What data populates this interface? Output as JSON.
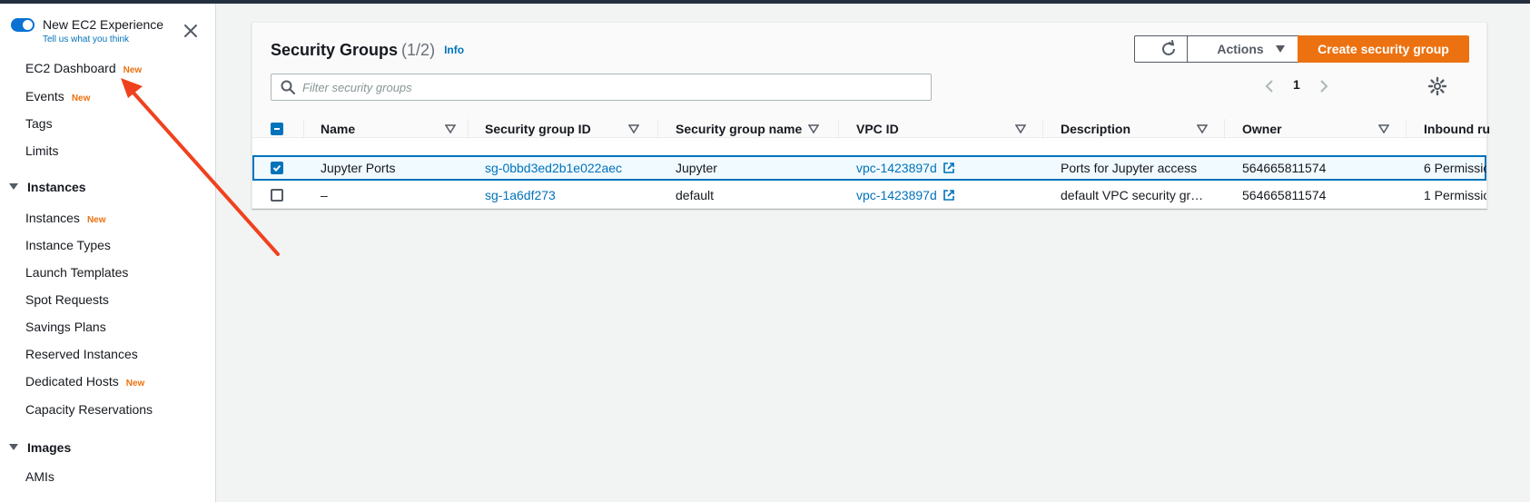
{
  "sidebar": {
    "experience_title": "New EC2 Experience",
    "experience_link": "Tell us what you think",
    "new_badge": "New",
    "items_top": [
      {
        "label": "EC2 Dashboard",
        "new": true
      },
      {
        "label": "Events",
        "new": true
      },
      {
        "label": "Tags",
        "new": false
      },
      {
        "label": "Limits",
        "new": false
      }
    ],
    "sections": [
      {
        "title": "Instances",
        "items": [
          {
            "label": "Instances",
            "new": true
          },
          {
            "label": "Instance Types",
            "new": false
          },
          {
            "label": "Launch Templates",
            "new": false
          },
          {
            "label": "Spot Requests",
            "new": false
          },
          {
            "label": "Savings Plans",
            "new": false
          },
          {
            "label": "Reserved Instances",
            "new": false
          },
          {
            "label": "Dedicated Hosts",
            "new": true
          },
          {
            "label": "Capacity Reservations",
            "new": false
          }
        ]
      },
      {
        "title": "Images",
        "items": [
          {
            "label": "AMIs",
            "new": false
          }
        ]
      }
    ]
  },
  "main": {
    "title": "Security Groups",
    "count": "(1/2)",
    "info": "Info",
    "actions_label": "Actions",
    "create_label": "Create security group",
    "search_placeholder": "Filter security groups",
    "page_number": "1",
    "columns": [
      "Name",
      "Security group ID",
      "Security group name",
      "VPC ID",
      "Description",
      "Owner",
      "Inbound ru"
    ],
    "rows": [
      {
        "selected": true,
        "name": "Jupyter Ports",
        "sg_id": "sg-0bbd3ed2b1e022aec",
        "sg_name": "Jupyter",
        "vpc_id": "vpc-1423897d",
        "description": "Ports for Jupyter access",
        "owner": "564665811574",
        "inbound": "6 Permissio"
      },
      {
        "selected": false,
        "name": "–",
        "sg_id": "sg-1a6df273",
        "sg_name": "default",
        "vpc_id": "vpc-1423897d",
        "description": "default VPC security gr…",
        "owner": "564665811574",
        "inbound": "1 Permissio"
      }
    ]
  },
  "colors": {
    "accent": "#0073bb",
    "primary_button": "#ec7211",
    "annotation_arrow": "#f0411e"
  },
  "icons": [
    "close-icon",
    "refresh-icon",
    "caret-down-icon",
    "search-icon",
    "chevron-left-icon",
    "chevron-right-icon",
    "gear-icon",
    "sort-icon",
    "external-link-icon",
    "annotation-arrow"
  ]
}
